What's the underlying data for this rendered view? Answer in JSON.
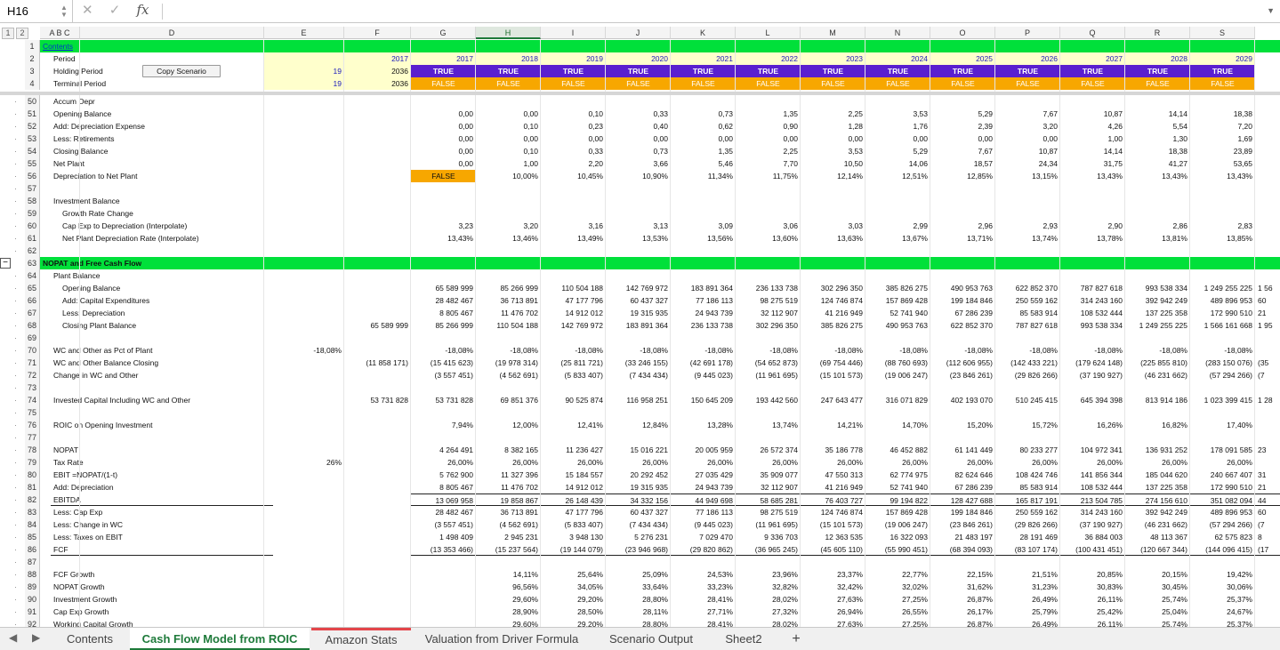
{
  "formula_bar": {
    "name_box": "H16",
    "cancel_icon": "✕",
    "enter_icon": "✓",
    "fx_label": "fx",
    "formula": ""
  },
  "outline_levels": [
    "1",
    "2"
  ],
  "columns": [
    "A B C",
    "D",
    "E",
    "F",
    "G",
    "H",
    "I",
    "J",
    "K",
    "L",
    "M",
    "N",
    "O",
    "P",
    "Q",
    "R",
    "S"
  ],
  "selected_column": "H",
  "copy_scenario_button": "Copy Scenario",
  "tabs": [
    {
      "label": "Contents"
    },
    {
      "label": "Cash Flow Model from ROIC"
    },
    {
      "label": "Amazon Stats"
    },
    {
      "label": "Valuation from Driver Formula"
    },
    {
      "label": "Scenario Output"
    },
    {
      "label": "Sheet2"
    }
  ],
  "add_sheet": "+",
  "colors": {
    "green": "#00e03a",
    "purple": "#5a1fcf",
    "orange": "#f7a700",
    "yellow_light": "#ffffcc",
    "tab_green": "#1e7a3a"
  },
  "rows": [
    {
      "n": "1",
      "cells": {
        "A": "Contents"
      }
    },
    {
      "n": "2",
      "cells": {
        "A": "Period",
        "F": "2017",
        "G": "2017",
        "H": "2018",
        "I": "2019",
        "J": "2020",
        "K": "2021",
        "L": "2022",
        "M": "2023",
        "N": "2024",
        "O": "2025",
        "P": "2026",
        "Q": "2027",
        "R": "2028",
        "S": "2029"
      }
    },
    {
      "n": "3",
      "cells": {
        "A": "Holding Period",
        "E": "19",
        "F": "2036",
        "G": "TRUE",
        "H": "TRUE",
        "I": "TRUE",
        "J": "TRUE",
        "K": "TRUE",
        "L": "TRUE",
        "M": "TRUE",
        "N": "TRUE",
        "O": "TRUE",
        "P": "TRUE",
        "Q": "TRUE",
        "R": "TRUE",
        "S": "TRUE"
      }
    },
    {
      "n": "4",
      "cells": {
        "A": "Terminal Period",
        "E": "19",
        "F": "2036",
        "G": "FALSE",
        "H": "FALSE",
        "I": "FALSE",
        "J": "FALSE",
        "K": "FALSE",
        "L": "FALSE",
        "M": "FALSE",
        "N": "FALSE",
        "O": "FALSE",
        "P": "FALSE",
        "Q": "FALSE",
        "R": "FALSE",
        "S": "FALSE"
      }
    },
    {
      "n": "50",
      "cells": {
        "A": "Accum Depr"
      }
    },
    {
      "n": "51",
      "cells": {
        "A": "Opening Balance",
        "G": "0,00",
        "H": "0,00",
        "I": "0,10",
        "J": "0,33",
        "K": "0,73",
        "L": "1,35",
        "M": "2,25",
        "N": "3,53",
        "O": "5,29",
        "P": "7,67",
        "Q": "10,87",
        "R": "14,14",
        "S": "18,38"
      }
    },
    {
      "n": "52",
      "cells": {
        "A": "Add: Depreciation Expense",
        "G": "0,00",
        "H": "0,10",
        "I": "0,23",
        "J": "0,40",
        "K": "0,62",
        "L": "0,90",
        "M": "1,28",
        "N": "1,76",
        "O": "2,39",
        "P": "3,20",
        "Q": "4,26",
        "R": "5,54",
        "S": "7,20"
      }
    },
    {
      "n": "53",
      "cells": {
        "A": "Less: Retirements",
        "G": "0,00",
        "H": "0,00",
        "I": "0,00",
        "J": "0,00",
        "K": "0,00",
        "L": "0,00",
        "M": "0,00",
        "N": "0,00",
        "O": "0,00",
        "P": "0,00",
        "Q": "1,00",
        "R": "1,30",
        "S": "1,69"
      }
    },
    {
      "n": "54",
      "cells": {
        "A": "Closing Balance",
        "G": "0,00",
        "H": "0,10",
        "I": "0,33",
        "J": "0,73",
        "K": "1,35",
        "L": "2,25",
        "M": "3,53",
        "N": "5,29",
        "O": "7,67",
        "P": "10,87",
        "Q": "14,14",
        "R": "18,38",
        "S": "23,89"
      }
    },
    {
      "n": "55",
      "cells": {
        "A": "Net Plant",
        "G": "0,00",
        "H": "1,00",
        "I": "2,20",
        "J": "3,66",
        "K": "5,46",
        "L": "7,70",
        "M": "10,50",
        "N": "14,06",
        "O": "18,57",
        "P": "24,34",
        "Q": "31,75",
        "R": "41,27",
        "S": "53,65"
      }
    },
    {
      "n": "56",
      "cells": {
        "A": "Depreciation to Net Plant",
        "G": "FALSE",
        "H": "10,00%",
        "I": "10,45%",
        "J": "10,90%",
        "K": "11,34%",
        "L": "11,75%",
        "M": "12,14%",
        "N": "12,51%",
        "O": "12,85%",
        "P": "13,15%",
        "Q": "13,43%",
        "R": "13,43%",
        "S": "13,43%"
      }
    },
    {
      "n": "57",
      "cells": {}
    },
    {
      "n": "58",
      "cells": {
        "A": "Investment Balance"
      }
    },
    {
      "n": "59",
      "cells": {
        "A": "Growth Rate Change"
      }
    },
    {
      "n": "60",
      "cells": {
        "A": "Cap Exp to Depreciation (Interpolate)",
        "G": "3,23",
        "H": "3,20",
        "I": "3,16",
        "J": "3,13",
        "K": "3,09",
        "L": "3,06",
        "M": "3,03",
        "N": "2,99",
        "O": "2,96",
        "P": "2,93",
        "Q": "2,90",
        "R": "2,86",
        "S": "2,83"
      }
    },
    {
      "n": "61",
      "cells": {
        "A": "Net Plant Depreciation Rate (Interpolate)",
        "G": "13,43%",
        "H": "13,46%",
        "I": "13,49%",
        "J": "13,53%",
        "K": "13,56%",
        "L": "13,60%",
        "M": "13,63%",
        "N": "13,67%",
        "O": "13,71%",
        "P": "13,74%",
        "Q": "13,78%",
        "R": "13,81%",
        "S": "13,85%"
      }
    },
    {
      "n": "62",
      "cells": {}
    },
    {
      "n": "63",
      "cells": {
        "A": "NOPAT and Free Cash Flow"
      }
    },
    {
      "n": "64",
      "cells": {
        "A": "Plant Balance"
      }
    },
    {
      "n": "65",
      "cells": {
        "A": "Opening Balance",
        "G": "65 589 999",
        "H": "85 266 999",
        "I": "110 504 188",
        "J": "142 769 972",
        "K": "183 891 364",
        "L": "236 133 738",
        "M": "302 296 350",
        "N": "385 826 275",
        "O": "490 953 763",
        "P": "622 852 370",
        "Q": "787 827 618",
        "R": "993 538 334",
        "S": "1 249 255 225",
        "T": "1 56"
      }
    },
    {
      "n": "66",
      "cells": {
        "A": "Add: Capital Expenditures",
        "G": "28 482 467",
        "H": "36 713 891",
        "I": "47 177 796",
        "J": "60 437 327",
        "K": "77 186 113",
        "L": "98 275 519",
        "M": "124 746 874",
        "N": "157 869 428",
        "O": "199 184 846",
        "P": "250 559 162",
        "Q": "314 243 160",
        "R": "392 942 249",
        "S": "489 896 953",
        "T": "60"
      }
    },
    {
      "n": "67",
      "cells": {
        "A": "Less: Depreciation",
        "G": "8 805 467",
        "H": "11 476 702",
        "I": "14 912 012",
        "J": "19 315 935",
        "K": "24 943 739",
        "L": "32 112 907",
        "M": "41 216 949",
        "N": "52 741 940",
        "O": "67 286 239",
        "P": "85 583 914",
        "Q": "108 532 444",
        "R": "137 225 358",
        "S": "172 990 510",
        "T": "21"
      }
    },
    {
      "n": "68",
      "cells": {
        "A": "Closing Plant Balance",
        "F": "65 589 999",
        "G": "85 266 999",
        "H": "110 504 188",
        "I": "142 769 972",
        "J": "183 891 364",
        "K": "236 133 738",
        "L": "302 296 350",
        "M": "385 826 275",
        "N": "490 953 763",
        "O": "622 852 370",
        "P": "787 827 618",
        "Q": "993 538 334",
        "R": "1 249 255 225",
        "S": "1 566 161 668",
        "T": "1 95"
      }
    },
    {
      "n": "69",
      "cells": {}
    },
    {
      "n": "70",
      "cells": {
        "A": "WC and Other as Pct of Plant",
        "E": "-18,08%",
        "G": "-18,08%",
        "H": "-18,08%",
        "I": "-18,08%",
        "J": "-18,08%",
        "K": "-18,08%",
        "L": "-18,08%",
        "M": "-18,08%",
        "N": "-18,08%",
        "O": "-18,08%",
        "P": "-18,08%",
        "Q": "-18,08%",
        "R": "-18,08%",
        "S": "-18,08%"
      }
    },
    {
      "n": "71",
      "cells": {
        "A": "WC and Other Balance Closing",
        "F": "(11 858 171)",
        "G": "(15 415 623)",
        "H": "(19 978 314)",
        "I": "(25 811 721)",
        "J": "(33 246 155)",
        "K": "(42 691 178)",
        "L": "(54 652 873)",
        "M": "(69 754 446)",
        "N": "(88 760 693)",
        "O": "(112 606 955)",
        "P": "(142 433 221)",
        "Q": "(179 624 148)",
        "R": "(225 855 810)",
        "S": "(283 150 076)",
        "T": "(35"
      }
    },
    {
      "n": "72",
      "cells": {
        "A": "Change in WC and Other",
        "G": "(3 557 451)",
        "H": "(4 562 691)",
        "I": "(5 833 407)",
        "J": "(7 434 434)",
        "K": "(9 445 023)",
        "L": "(11 961 695)",
        "M": "(15 101 573)",
        "N": "(19 006 247)",
        "O": "(23 846 261)",
        "P": "(29 826 266)",
        "Q": "(37 190 927)",
        "R": "(46 231 662)",
        "S": "(57 294 266)",
        "T": "(7"
      }
    },
    {
      "n": "73",
      "cells": {}
    },
    {
      "n": "74",
      "cells": {
        "A": "Invested Capital Including WC and Other",
        "F": "53 731 828",
        "G": "53 731 828",
        "H": "69 851 376",
        "I": "90 525 874",
        "J": "116 958 251",
        "K": "150 645 209",
        "L": "193 442 560",
        "M": "247 643 477",
        "N": "316 071 829",
        "O": "402 193 070",
        "P": "510 245 415",
        "Q": "645 394 398",
        "R": "813 914 186",
        "S": "1 023 399 415",
        "T": "1 28"
      }
    },
    {
      "n": "75",
      "cells": {}
    },
    {
      "n": "76",
      "cells": {
        "A": "ROIC on Opening Investment",
        "G": "7,94%",
        "H": "12,00%",
        "I": "12,41%",
        "J": "12,84%",
        "K": "13,28%",
        "L": "13,74%",
        "M": "14,21%",
        "N": "14,70%",
        "O": "15,20%",
        "P": "15,72%",
        "Q": "16,26%",
        "R": "16,82%",
        "S": "17,40%"
      }
    },
    {
      "n": "77",
      "cells": {}
    },
    {
      "n": "78",
      "cells": {
        "A": "NOPAT",
        "G": "4 264 491",
        "H": "8 382 165",
        "I": "11 236 427",
        "J": "15 016 221",
        "K": "20 005 959",
        "L": "26 572 374",
        "M": "35 186 778",
        "N": "46 452 882",
        "O": "61 141 449",
        "P": "80 233 277",
        "Q": "104 972 341",
        "R": "136 931 252",
        "S": "178 091 585",
        "T": "23"
      }
    },
    {
      "n": "79",
      "cells": {
        "A": "Tax Rate",
        "E": "26%",
        "G": "26,00%",
        "H": "26,00%",
        "I": "26,00%",
        "J": "26,00%",
        "K": "26,00%",
        "L": "26,00%",
        "M": "26,00%",
        "N": "26,00%",
        "O": "26,00%",
        "P": "26,00%",
        "Q": "26,00%",
        "R": "26,00%",
        "S": "26,00%"
      }
    },
    {
      "n": "80",
      "cells": {
        "A": "EBIT =NOPAT/(1-t)",
        "G": "5 762 900",
        "H": "11 327 396",
        "I": "15 184 557",
        "J": "20 292 452",
        "K": "27 035 429",
        "L": "35 909 077",
        "M": "47 550 313",
        "N": "62 774 975",
        "O": "82 624 646",
        "P": "108 424 746",
        "Q": "141 856 344",
        "R": "185 044 620",
        "S": "240 667 407",
        "T": "31"
      }
    },
    {
      "n": "81",
      "cells": {
        "A": "Add: Depreciation",
        "G": "8 805 467",
        "H": "11 476 702",
        "I": "14 912 012",
        "J": "19 315 935",
        "K": "24 943 739",
        "L": "32 112 907",
        "M": "41 216 949",
        "N": "52 741 940",
        "O": "67 286 239",
        "P": "85 583 914",
        "Q": "108 532 444",
        "R": "137 225 358",
        "S": "172 990 510",
        "T": "21"
      }
    },
    {
      "n": "82",
      "cells": {
        "A": "EBITDA",
        "G": "13 069 958",
        "H": "19 858 867",
        "I": "26 148 439",
        "J": "34 332 156",
        "K": "44 949 698",
        "L": "58 685 281",
        "M": "76 403 727",
        "N": "99 194 822",
        "O": "128 427 688",
        "P": "165 817 191",
        "Q": "213 504 785",
        "R": "274 156 610",
        "S": "351 082 094",
        "T": "44"
      }
    },
    {
      "n": "83",
      "cells": {
        "A": "Less: Cap Exp",
        "G": "28 482 467",
        "H": "36 713 891",
        "I": "47 177 796",
        "J": "60 437 327",
        "K": "77 186 113",
        "L": "98 275 519",
        "M": "124 746 874",
        "N": "157 869 428",
        "O": "199 184 846",
        "P": "250 559 162",
        "Q": "314 243 160",
        "R": "392 942 249",
        "S": "489 896 953",
        "T": "60"
      }
    },
    {
      "n": "84",
      "cells": {
        "A": "Less: Change in WC",
        "G": "(3 557 451)",
        "H": "(4 562 691)",
        "I": "(5 833 407)",
        "J": "(7 434 434)",
        "K": "(9 445 023)",
        "L": "(11 961 695)",
        "M": "(15 101 573)",
        "N": "(19 006 247)",
        "O": "(23 846 261)",
        "P": "(29 826 266)",
        "Q": "(37 190 927)",
        "R": "(46 231 662)",
        "S": "(57 294 266)",
        "T": "(7"
      }
    },
    {
      "n": "85",
      "cells": {
        "A": "Less: Taxes on EBIT",
        "G": "1 498 409",
        "H": "2 945 231",
        "I": "3 948 130",
        "J": "5 276 231",
        "K": "7 029 470",
        "L": "9 336 703",
        "M": "12 363 535",
        "N": "16 322 093",
        "O": "21 483 197",
        "P": "28 191 469",
        "Q": "36 884 003",
        "R": "48 113 367",
        "S": "62 575 823",
        "T": "8"
      }
    },
    {
      "n": "86",
      "cells": {
        "A": "FCF",
        "G": "(13 353 466)",
        "H": "(15 237 564)",
        "I": "(19 144 079)",
        "J": "(23 946 968)",
        "K": "(29 820 862)",
        "L": "(36 965 245)",
        "M": "(45 605 110)",
        "N": "(55 990 451)",
        "O": "(68 394 093)",
        "P": "(83 107 174)",
        "Q": "(100 431 451)",
        "R": "(120 667 344)",
        "S": "(144 096 415)",
        "T": "(17"
      }
    },
    {
      "n": "87",
      "cells": {}
    },
    {
      "n": "88",
      "cells": {
        "A": "FCF Growth",
        "H": "14,11%",
        "I": "25,64%",
        "J": "25,09%",
        "K": "24,53%",
        "L": "23,96%",
        "M": "23,37%",
        "N": "22,77%",
        "O": "22,15%",
        "P": "21,51%",
        "Q": "20,85%",
        "R": "20,15%",
        "S": "19,42%"
      }
    },
    {
      "n": "89",
      "cells": {
        "A": "NOPAT Growth",
        "H": "96,56%",
        "I": "34,05%",
        "J": "33,64%",
        "K": "33,23%",
        "L": "32,82%",
        "M": "32,42%",
        "N": "32,02%",
        "O": "31,62%",
        "P": "31,23%",
        "Q": "30,83%",
        "R": "30,45%",
        "S": "30,06%"
      }
    },
    {
      "n": "90",
      "cells": {
        "A": "Investment Growth",
        "H": "29,60%",
        "I": "29,20%",
        "J": "28,80%",
        "K": "28,41%",
        "L": "28,02%",
        "M": "27,63%",
        "N": "27,25%",
        "O": "26,87%",
        "P": "26,49%",
        "Q": "26,11%",
        "R": "25,74%",
        "S": "25,37%"
      }
    },
    {
      "n": "91",
      "cells": {
        "A": "Cap Exp Growth",
        "H": "28,90%",
        "I": "28,50%",
        "J": "28,11%",
        "K": "27,71%",
        "L": "27,32%",
        "M": "26,94%",
        "N": "26,55%",
        "O": "26,17%",
        "P": "25,79%",
        "Q": "25,42%",
        "R": "25,04%",
        "S": "24,67%"
      }
    },
    {
      "n": "92",
      "cells": {
        "A": "Working Capital Growth",
        "H": "29,60%",
        "I": "29,20%",
        "J": "28,80%",
        "K": "28,41%",
        "L": "28,02%",
        "M": "27,63%",
        "N": "27,25%",
        "O": "26,87%",
        "P": "26,49%",
        "Q": "26,11%",
        "R": "25,74%",
        "S": "25,37%"
      }
    }
  ]
}
